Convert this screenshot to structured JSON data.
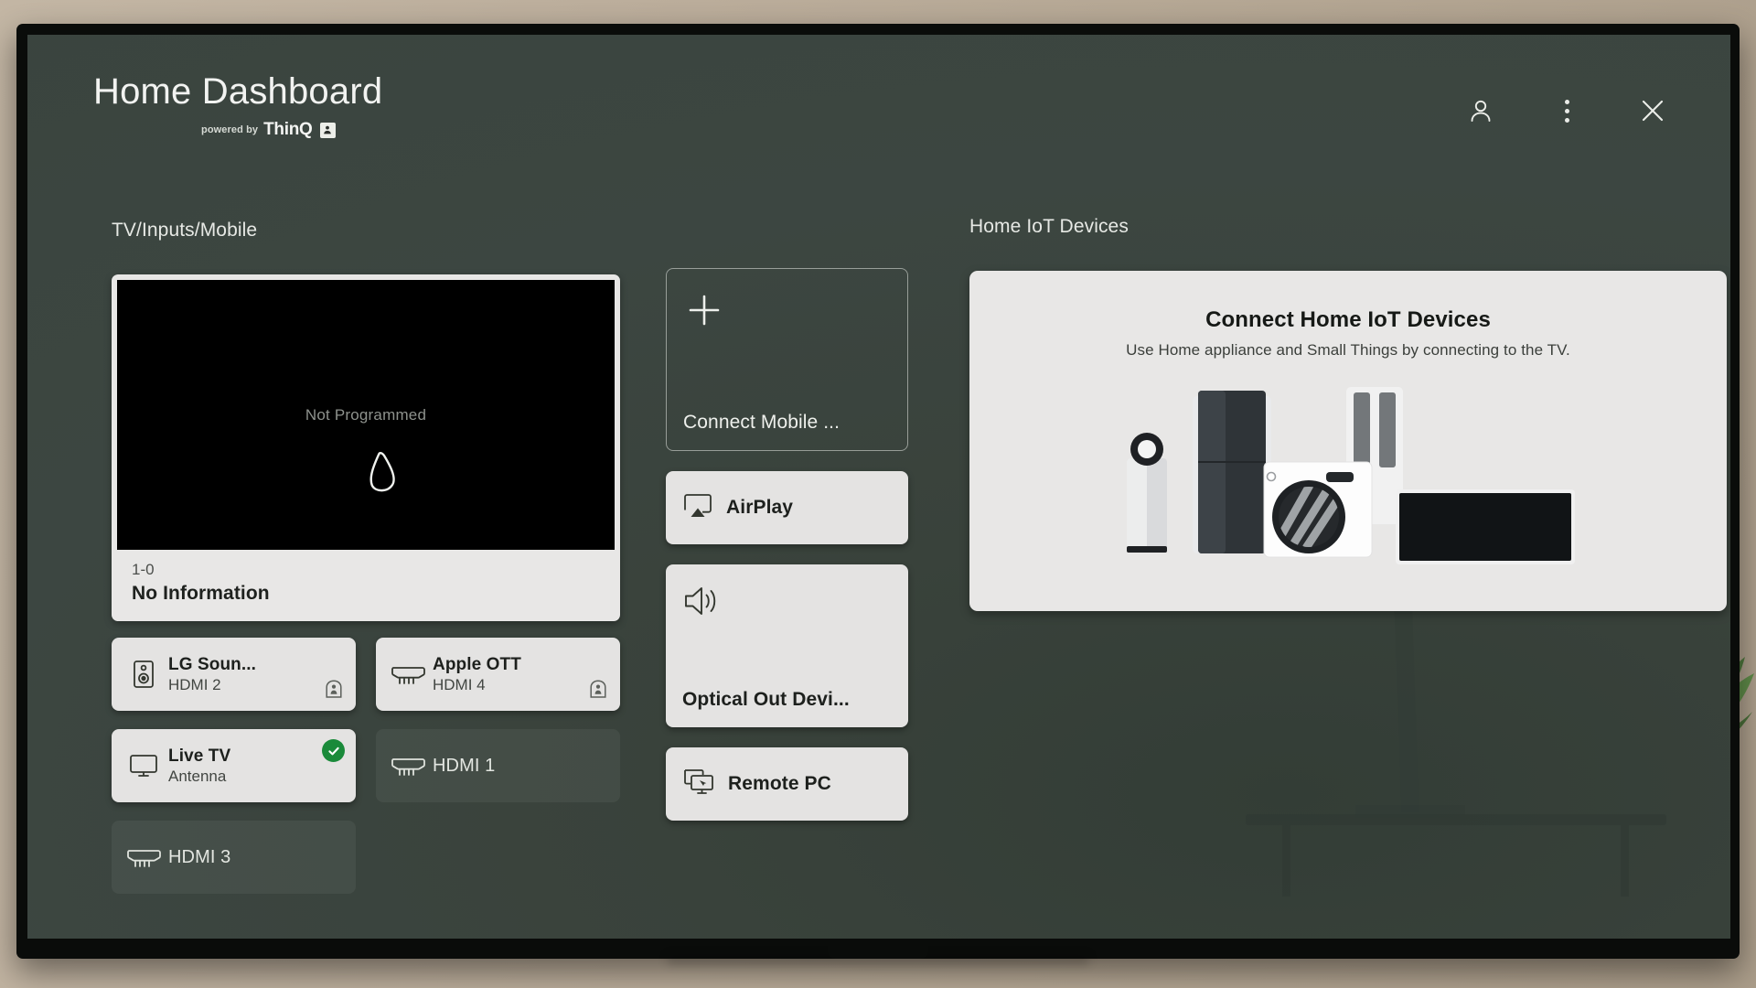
{
  "header": {
    "title": "Home Dashboard",
    "powered_by": "powered by",
    "brand": "ThinQ",
    "actions": [
      {
        "name": "account",
        "icon": "person-icon"
      },
      {
        "name": "more",
        "icon": "more-vertical-icon"
      },
      {
        "name": "close",
        "icon": "close-icon"
      }
    ]
  },
  "left": {
    "section_label": "TV/Inputs/Mobile",
    "preview": {
      "screen_message": "Not Programmed",
      "channel": "1-0",
      "program": "No Information"
    },
    "tiles": [
      {
        "name": "LG Soun...",
        "sub": "HDMI 2",
        "icon": "speaker-icon",
        "state": "light",
        "badge": "connected-device-badge",
        "checked": false
      },
      {
        "name": "Apple OTT",
        "sub": "HDMI 4",
        "icon": "hdmi-icon",
        "state": "light",
        "badge": "connected-device-badge",
        "checked": false
      },
      {
        "name": "Live TV",
        "sub": "Antenna",
        "icon": "tv-monitor-icon",
        "state": "light",
        "badge": null,
        "checked": true
      },
      {
        "name": "HDMI 1",
        "sub": "",
        "icon": "hdmi-icon",
        "state": "dim",
        "badge": null,
        "checked": false
      },
      {
        "name": "HDMI 3",
        "sub": "",
        "icon": "hdmi-icon",
        "state": "dim",
        "badge": null,
        "checked": false
      }
    ]
  },
  "middle": {
    "connect_mobile": {
      "label": "Connect Mobile ...",
      "icon": "plus-icon"
    },
    "buttons": [
      {
        "label": "AirPlay",
        "icon": "airplay-icon",
        "layout": "row"
      },
      {
        "label": "Optical Out Devi...",
        "icon": "speaker-wave-icon",
        "layout": "tall"
      },
      {
        "label": "Remote PC",
        "icon": "remote-pc-icon",
        "layout": "row"
      }
    ]
  },
  "right": {
    "section_label": "Home IoT Devices",
    "card": {
      "title": "Connect Home IoT Devices",
      "subtitle": "Use Home appliance and Small Things by connecting to the TV.",
      "art": "home-appliances-illustration"
    }
  },
  "colors": {
    "screen_bg": "#3c4641",
    "card_bg": "#e8e7e6",
    "accent_green": "#1a8a3a",
    "text_light": "#f2f3f1",
    "text_dark": "#1d201d",
    "wall": "#b8aa98",
    "bezel": "#0a0c0a"
  }
}
